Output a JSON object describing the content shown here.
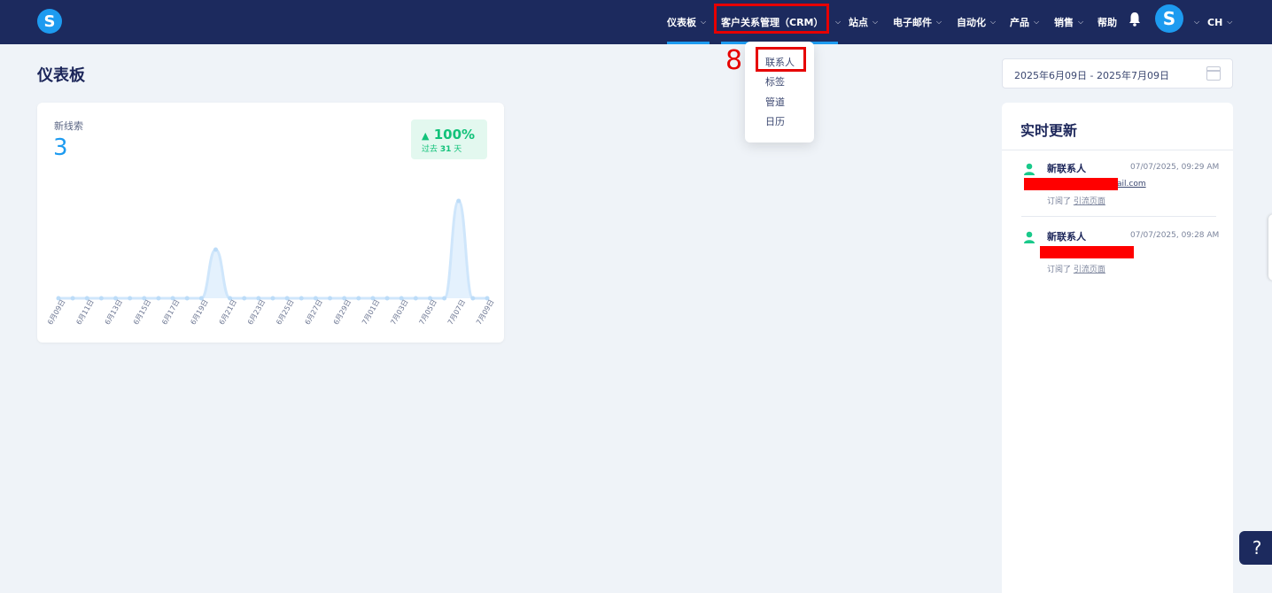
{
  "nav": {
    "logo": "S",
    "items": [
      {
        "label": "仪表板"
      },
      {
        "label": "客户关系管理（CRM）"
      },
      {
        "label": "站点"
      },
      {
        "label": "电子邮件"
      },
      {
        "label": "自动化"
      },
      {
        "label": "产品"
      },
      {
        "label": "销售"
      },
      {
        "label": "帮助"
      }
    ],
    "avatar": "S",
    "lang": "CH"
  },
  "annotation": {
    "number": "8"
  },
  "dropdown": {
    "items": [
      "联系人",
      "标签",
      "管道",
      "日历"
    ]
  },
  "page": {
    "title": "仪表板"
  },
  "date_range": "2025年6月09日 - 2025年7月09日",
  "card": {
    "label": "新线索",
    "value": "3",
    "badge_pct": "100%",
    "badge_prefix": "过去",
    "badge_days": "31",
    "badge_suffix": "天"
  },
  "chart_data": {
    "type": "area",
    "x": [
      "6月09日",
      "6月10日",
      "6月11日",
      "6月12日",
      "6月13日",
      "6月14日",
      "6月15日",
      "6月16日",
      "6月17日",
      "6月18日",
      "6月19日",
      "6月20日",
      "6月21日",
      "6月22日",
      "6月23日",
      "6月24日",
      "6月25日",
      "6月26日",
      "6月27日",
      "6月28日",
      "6月29日",
      "6月30日",
      "7月01日",
      "7月02日",
      "7月03日",
      "7月04日",
      "7月05日",
      "7月06日",
      "7月07日",
      "7月08日",
      "7月09日"
    ],
    "tick_labels": [
      "6月09日",
      "6月11日",
      "6月13日",
      "6月15日",
      "6月17日",
      "6月19日",
      "6月21日",
      "6月23日",
      "6月25日",
      "6月27日",
      "6月29日",
      "7月01日",
      "7月03日",
      "7月05日",
      "7月07日",
      "7月09日"
    ],
    "values": [
      0,
      0,
      0,
      0,
      0,
      0,
      0,
      0,
      0,
      0,
      0,
      1,
      0,
      0,
      0,
      0,
      0,
      0,
      0,
      0,
      0,
      0,
      0,
      0,
      0,
      0,
      0,
      0,
      2,
      0,
      0
    ],
    "ylim": [
      0,
      2
    ],
    "grid": false,
    "color": "#cfe6fb",
    "point_color": "#bcdcf8"
  },
  "live": {
    "title": "实时更新",
    "updates": [
      {
        "title": "新联系人",
        "time": "07/07/2025, 09:29 AM",
        "email_tail": "ail.com",
        "sub_prefix": "订阅了",
        "sub_link": "引流页面"
      },
      {
        "title": "新联系人",
        "time": "07/07/2025, 09:28 AM",
        "email_tail": "",
        "sub_prefix": "订阅了",
        "sub_link": "引流页面"
      }
    ]
  },
  "help": "?"
}
